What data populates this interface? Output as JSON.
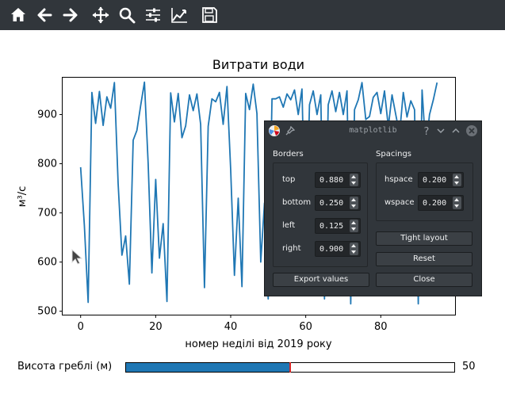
{
  "toolbar": {
    "buttons": [
      {
        "name": "home-button",
        "icon": "home-icon"
      },
      {
        "name": "back-button",
        "icon": "arrow-left-icon"
      },
      {
        "name": "forward-button",
        "icon": "arrow-right-icon"
      },
      {
        "name": "pan-button",
        "icon": "move-icon"
      },
      {
        "name": "zoom-button",
        "icon": "magnifier-icon"
      },
      {
        "name": "subplots-button",
        "icon": "sliders-icon"
      },
      {
        "name": "customize-button",
        "icon": "line-chart-icon"
      },
      {
        "name": "save-button",
        "icon": "floppy-disk-icon"
      }
    ]
  },
  "chart_data": {
    "type": "line",
    "title": "Витрати води",
    "xlabel": "номер неділі від 2019 року",
    "ylabel": "м³/с",
    "xlim": [
      -4.8,
      99.8
    ],
    "ylim": [
      493,
      975
    ],
    "xticks": [
      0,
      20,
      40,
      60,
      80
    ],
    "yticks": [
      500,
      600,
      700,
      800,
      900
    ],
    "color": "#1f77b4",
    "series": [
      {
        "x": [
          0,
          1,
          2,
          3,
          4,
          5,
          6,
          7,
          8,
          9,
          10,
          11,
          12,
          13,
          14,
          15,
          16,
          17,
          18,
          19,
          20,
          21,
          22,
          23,
          24,
          25,
          26,
          27,
          28,
          29,
          30,
          31,
          32,
          33,
          34,
          35,
          36,
          37,
          38,
          39,
          40,
          41,
          42,
          43,
          44,
          45,
          46,
          47,
          48,
          49,
          50,
          51,
          52,
          53,
          54,
          55,
          56,
          57,
          58,
          59,
          60,
          61,
          62,
          63,
          64,
          65,
          66,
          67,
          68,
          69,
          70,
          71,
          72,
          73,
          74,
          75,
          76,
          77,
          78,
          79,
          80,
          81,
          82,
          83,
          84,
          85,
          86,
          87,
          88,
          89,
          90,
          91,
          92,
          93,
          94,
          95
        ],
        "y": [
          793,
          675,
          518,
          945,
          882,
          947,
          878,
          936,
          913,
          965,
          760,
          614,
          653,
          555,
          848,
          868,
          918,
          966,
          800,
          578,
          768,
          608,
          678,
          520,
          944,
          885,
          943,
          853,
          877,
          940,
          908,
          942,
          880,
          548,
          876,
          932,
          926,
          945,
          880,
          957,
          787,
          573,
          730,
          550,
          943,
          910,
          962,
          902,
          600,
          720,
          525,
          932,
          932,
          936,
          915,
          942,
          930,
          950,
          900,
          952,
          620,
          920,
          948,
          900,
          940,
          525,
          920,
          948,
          906,
          945,
          900,
          948,
          515,
          910,
          930,
          965,
          890,
          896,
          935,
          945,
          902,
          948,
          875,
          940,
          900,
          860,
          945,
          895,
          928,
          910,
          515,
          950,
          830,
          900,
          930,
          965
        ]
      }
    ]
  },
  "slider": {
    "label": "Висота греблі (м)",
    "value": 50,
    "min": 0,
    "max": 100,
    "value_text": "50"
  },
  "dialog": {
    "title": "matplotlib",
    "borders_label": "Borders",
    "spacings_label": "Spacings",
    "borders": [
      {
        "label": "top",
        "value": "0.880"
      },
      {
        "label": "bottom",
        "value": "0.250"
      },
      {
        "label": "left",
        "value": "0.125"
      },
      {
        "label": "right",
        "value": "0.900"
      }
    ],
    "spacings": [
      {
        "label": "hspace",
        "value": "0.200"
      },
      {
        "label": "wspace",
        "value": "0.200"
      }
    ],
    "tight_layout_label": "Tight layout",
    "reset_label": "Reset",
    "export_label": "Export values",
    "close_label": "Close",
    "accent": "#3daee9"
  }
}
